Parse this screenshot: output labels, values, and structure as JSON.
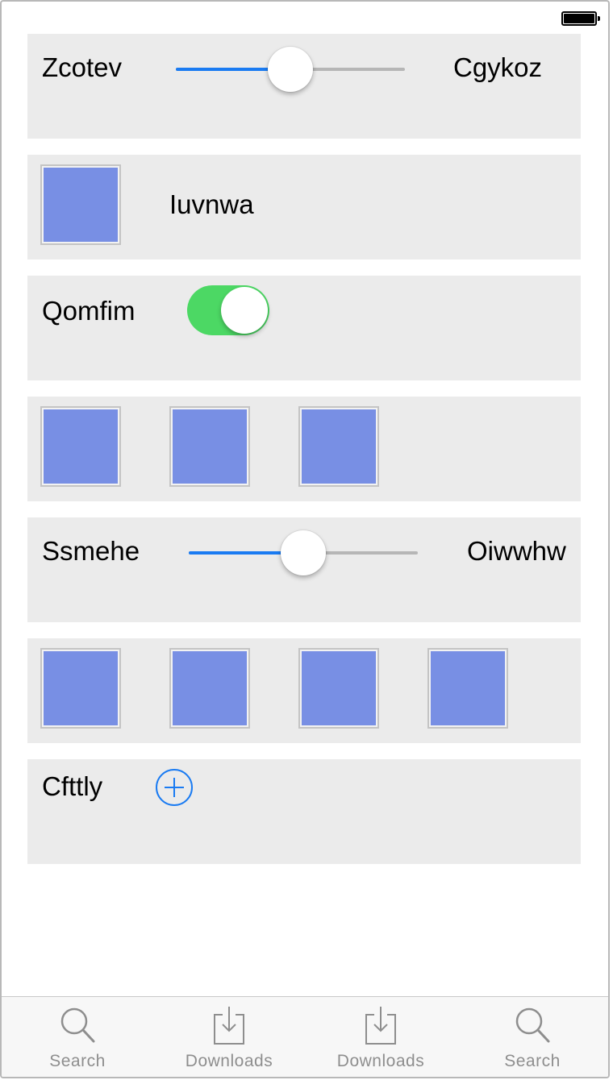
{
  "status_bar": {
    "battery_level": 1.0
  },
  "rows": {
    "slider1": {
      "left_label": "Zcotev",
      "right_label": "Cgykoz",
      "value": 0.5
    },
    "image_row1": {
      "label": "Iuvnwa",
      "image_count": 1
    },
    "toggle_row": {
      "label": "Qomfim",
      "on": true
    },
    "image_row2": {
      "image_count": 3
    },
    "slider2": {
      "left_label": "Ssmehe",
      "right_label": "Oiwwhw",
      "value": 0.5
    },
    "image_row3": {
      "image_count": 4
    },
    "add_row": {
      "label": "Cfttly"
    }
  },
  "colors": {
    "accent": "#1a7bf2",
    "toggle_on": "#4cd864",
    "image_placeholder": "#788fe4",
    "card_background": "#ebebeb",
    "tab_label": "#8e8e8e"
  },
  "tab_bar": {
    "tabs": [
      {
        "label": "Search",
        "icon": "search-icon"
      },
      {
        "label": "Downloads",
        "icon": "download-icon"
      },
      {
        "label": "Downloads",
        "icon": "download-icon"
      },
      {
        "label": "Search",
        "icon": "search-icon"
      }
    ]
  }
}
